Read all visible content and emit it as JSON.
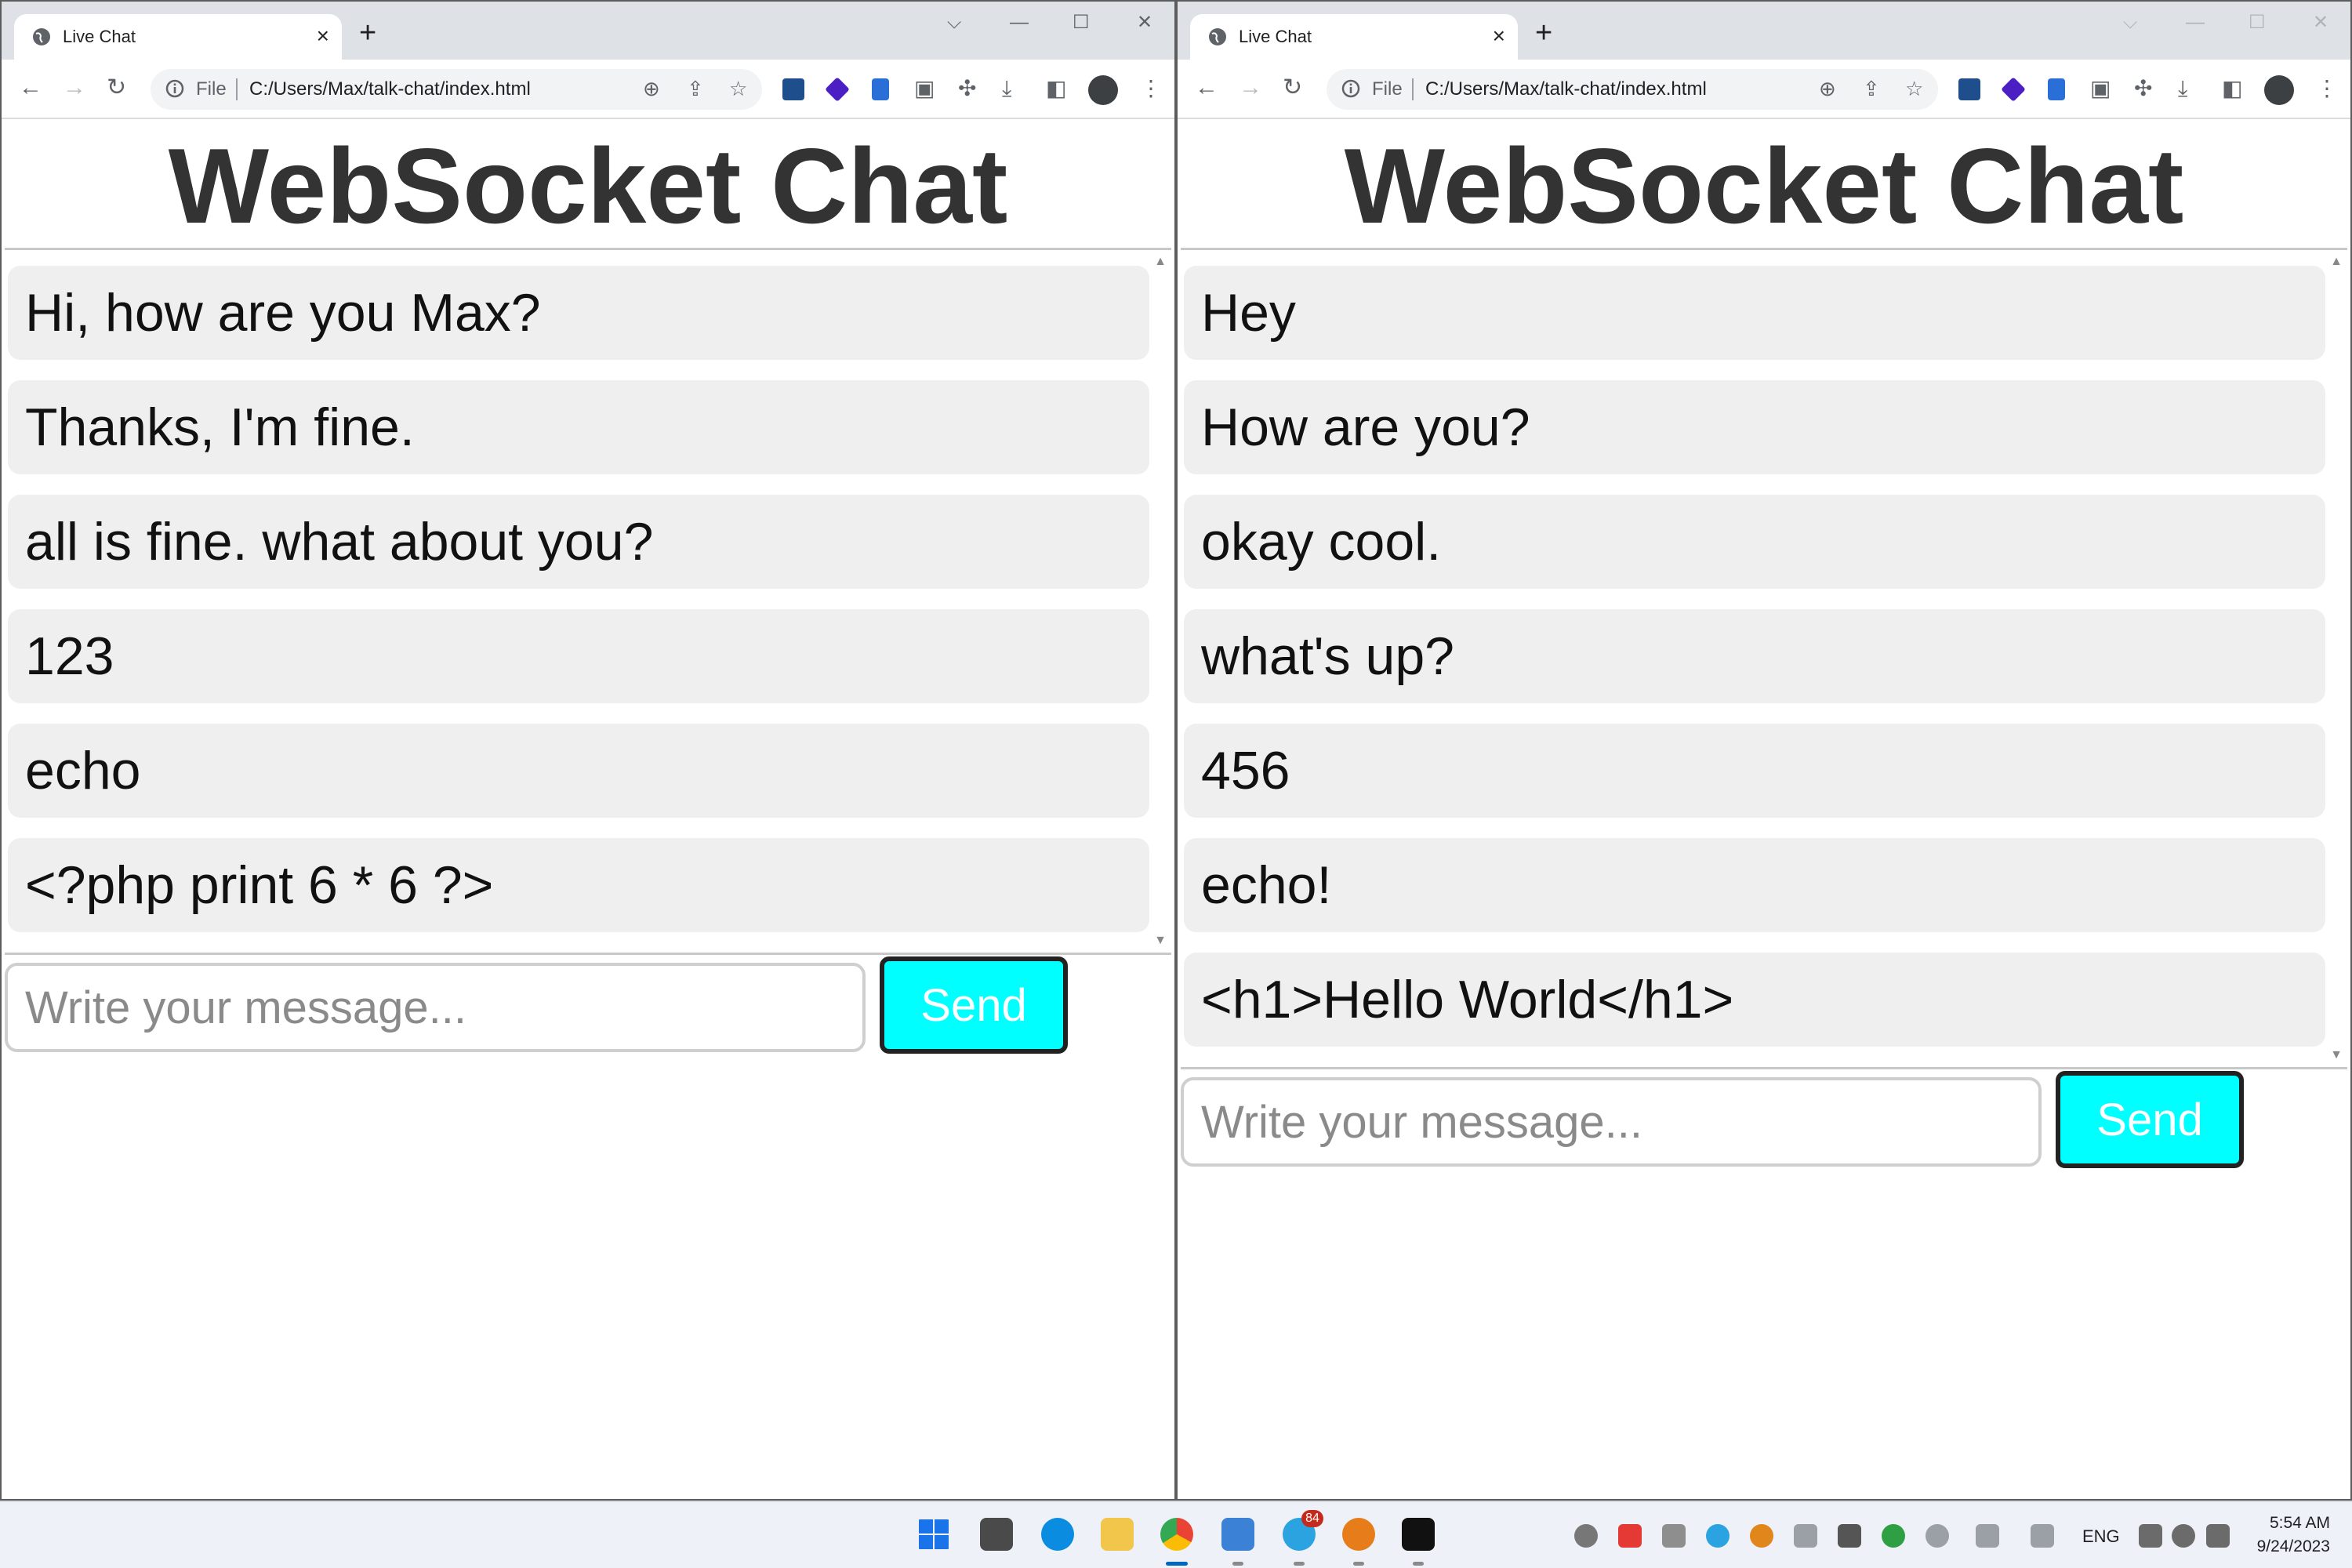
{
  "windows": [
    {
      "tab_title": "Live Chat",
      "address_scheme": "File",
      "url": "C:/Users/Max/talk-chat/index.html",
      "page_title": "WebSocket Chat",
      "messages": [
        "Hi, how are you Max?",
        "Thanks, I'm fine.",
        "all is fine. what about you?",
        "123",
        "echo",
        "<?php print 6 * 6 ?>"
      ],
      "input_placeholder": "Write your message...",
      "send_label": "Send"
    },
    {
      "tab_title": "Live Chat",
      "address_scheme": "File",
      "url": "C:/Users/Max/talk-chat/index.html",
      "page_title": "WebSocket Chat",
      "messages": [
        "Hey",
        "How are you?",
        "okay cool.",
        "what's up?",
        "456",
        "echo!",
        "<h1>Hello World</h1>"
      ],
      "input_placeholder": "Write your message...",
      "send_label": "Send"
    }
  ],
  "icons": {
    "tab": [
      "globe-icon",
      "close-icon"
    ],
    "toolbar": [
      "back-arrow-icon",
      "forward-arrow-icon",
      "reload-icon",
      "info-icon",
      "zoom-icon",
      "share-icon",
      "bookmark-star-icon",
      "puzzle-extensions-icon",
      "download-icon",
      "side-panel-icon",
      "menu-dots-icon"
    ]
  },
  "colors": {
    "send_button": "#00ffff",
    "message_bubble": "#efefef",
    "title_text": "#333333"
  },
  "taskbar": {
    "telegram_badge": "84",
    "language": "ENG",
    "time": "5:54 AM",
    "date": "9/24/2023"
  }
}
